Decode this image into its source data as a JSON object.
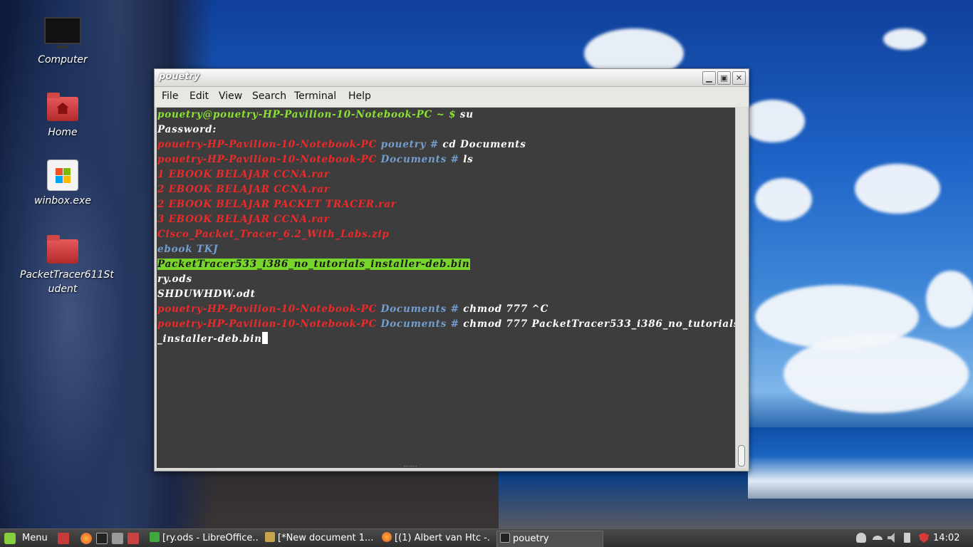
{
  "desktop": {
    "icons": [
      {
        "label": "Computer",
        "icon": "monitor-icon"
      },
      {
        "label": "Home",
        "icon": "home-folder-icon"
      },
      {
        "label": "winbox.exe",
        "icon": "windows-exe-icon"
      },
      {
        "label_line1": "PacketTracer611St",
        "label_line2": "udent",
        "icon": "folder-icon"
      }
    ]
  },
  "window": {
    "title": "pouetry",
    "controls": {
      "minimize": "▁",
      "maximize": "▣",
      "close": "✕"
    },
    "menu": [
      "File",
      "Edit",
      "View",
      "Search",
      "Terminal",
      "Help"
    ]
  },
  "terminal": {
    "colors": {
      "background": "#3d3d3d",
      "user_prompt": "#8ae234",
      "root_prompt": "#ef2929",
      "directory": "#729fcf",
      "highlight": "#78d52c"
    },
    "lines": [
      {
        "prompt": "pouetry@pouetry-HP-Pavilion-10-Notebook-PC ~ $",
        "cmd": " su"
      },
      {
        "text": "Password:"
      },
      {
        "host": "pouetry-HP-Pavilion-10-Notebook-PC",
        "dir": " pouetry #",
        "cmd": " cd Documents"
      },
      {
        "host": "pouetry-HP-Pavilion-10-Notebook-PC",
        "dir": " Documents #",
        "cmd": " ls"
      },
      {
        "text": "1 EBOOK BELAJAR CCNA.rar",
        "color": "red"
      },
      {
        "text": "2 EBOOK BELAJAR CCNA.rar",
        "color": "red"
      },
      {
        "text": "2 EBOOK BELAJAR PACKET TRACER.rar",
        "color": "red"
      },
      {
        "text": "3 EBOOK BELAJAR CCNA.rar",
        "color": "red"
      },
      {
        "text": "Cisco_Packet_Tracer_6.2_With_Labs.zip",
        "color": "red"
      },
      {
        "text": "ebook TKJ",
        "color": "blue"
      },
      {
        "text": "PacketTracer533_i386_no_tutorials_installer-deb.bin",
        "color": "highlight"
      },
      {
        "text": "ry.ods",
        "color": "white"
      },
      {
        "text": "SHDUWHDW.odt",
        "color": "white"
      },
      {
        "host": "pouetry-HP-Pavilion-10-Notebook-PC",
        "dir": " Documents #",
        "cmd": " chmod 777 ^C"
      },
      {
        "host": "pouetry-HP-Pavilion-10-Notebook-PC",
        "dir": " Documents #",
        "cmd": " chmod 777 PacketTracer533_i386_no_tutorials"
      },
      {
        "text": "_installer-deb.bin",
        "color": "white"
      }
    ]
  },
  "taskbar": {
    "menu_label": "Menu",
    "launchers": [
      "show-desktop-icon",
      "firefox-icon",
      "terminal-icon",
      "screenshot-icon",
      "files-icon"
    ],
    "tasks": [
      {
        "label": "[ry.ods - LibreOffice...",
        "icon": "calc-icon"
      },
      {
        "label": "[*New document 1...",
        "icon": "text-editor-icon"
      },
      {
        "label": "[(1) Albert van Htc -...",
        "icon": "firefox-icon"
      },
      {
        "label": "pouetry",
        "icon": "terminal-icon"
      }
    ],
    "tray_icons": [
      "user-icon",
      "wifi-icon",
      "volume-icon",
      "battery-icon",
      "shield-update-icon"
    ],
    "clock": "14:02"
  }
}
